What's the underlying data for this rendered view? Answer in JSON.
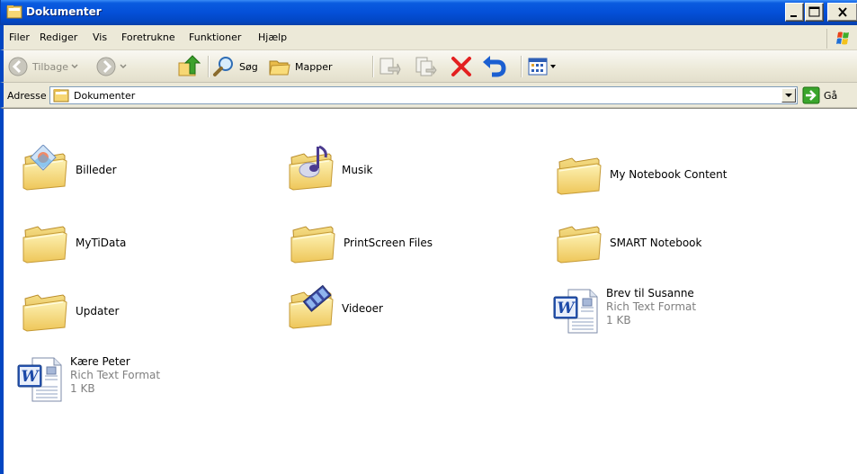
{
  "window": {
    "title": "Dokumenter"
  },
  "menu": {
    "items": [
      "Filer",
      "Rediger",
      "Vis",
      "Foretrukne",
      "Funktioner",
      "Hjælp"
    ]
  },
  "toolbar": {
    "back_label": "Tilbage",
    "search_label": "Søg",
    "folders_label": "Mapper"
  },
  "address": {
    "label": "Adresse",
    "value": "Dokumenter",
    "go_label": "Gå"
  },
  "items": [
    {
      "name": "Billeder"
    },
    {
      "name": "Musik"
    },
    {
      "name": "My Notebook Content"
    },
    {
      "name": "MyTiData"
    },
    {
      "name": "PrintScreen Files"
    },
    {
      "name": "SMART Notebook"
    },
    {
      "name": "Updater"
    },
    {
      "name": "Videoer"
    },
    {
      "name": "Brev til Susanne",
      "type": "Rich Text Format",
      "size": "1 KB"
    },
    {
      "name": "Kære Peter",
      "type": "Rich Text Format",
      "size": "1 KB"
    }
  ],
  "colors": {
    "titlebar": "#0450d8",
    "chrome": "#ece9d8",
    "folder": "#f7d774",
    "delete": "#e32020"
  }
}
